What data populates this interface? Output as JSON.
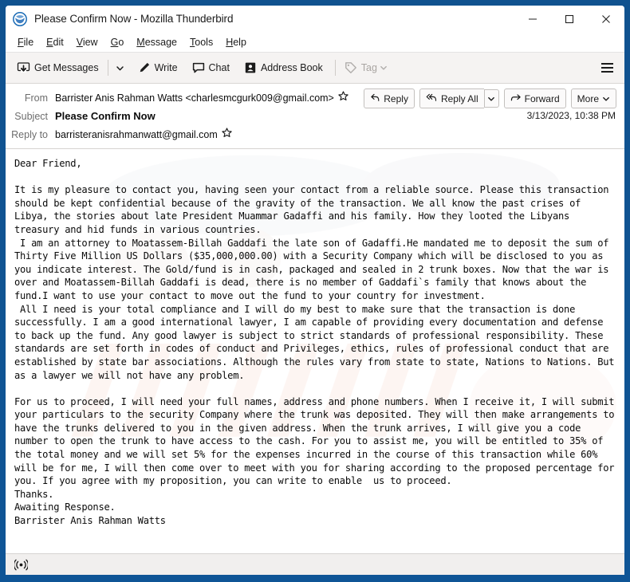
{
  "window": {
    "title": "Please Confirm Now - Mozilla Thunderbird",
    "app_icon": "thunderbird-icon",
    "controls": {
      "minimize": "minimize-icon",
      "maximize": "maximize-icon",
      "close": "close-icon"
    },
    "frame_color": "#0f5596"
  },
  "menubar": {
    "items": [
      {
        "label": "File",
        "accel": "F"
      },
      {
        "label": "Edit",
        "accel": "E"
      },
      {
        "label": "View",
        "accel": "V"
      },
      {
        "label": "Go",
        "accel": "G"
      },
      {
        "label": "Message",
        "accel": "M"
      },
      {
        "label": "Tools",
        "accel": "T"
      },
      {
        "label": "Help",
        "accel": "H"
      }
    ]
  },
  "toolbar": {
    "get_messages_label": "Get Messages",
    "write_label": "Write",
    "chat_label": "Chat",
    "address_book_label": "Address Book",
    "tag_label": "Tag",
    "tag_disabled": true,
    "menu_icon": "hamburger-icon"
  },
  "message_header": {
    "from_label": "From",
    "from_value": "Barrister Anis Rahman Watts <charlesmcgurk009@gmail.com>",
    "subject_label": "Subject",
    "subject_value": "Please Confirm Now",
    "reply_to_label": "Reply to",
    "reply_to_value": "barristeranisrahmanwatt@gmail.com",
    "date": "3/13/2023, 10:38 PM",
    "actions": {
      "reply": "Reply",
      "reply_all": "Reply All",
      "forward": "Forward",
      "more": "More"
    }
  },
  "message_body": {
    "text": "Dear Friend,\n\nIt is my pleasure to contact you, having seen your contact from a reliable source. Please this transaction should be kept confidential because of the gravity of the transaction. We all know the past crises of Libya, the stories about late President Muammar Gadaffi and his family. How they looted the Libyans treasury and hid funds in various countries.\n I am an attorney to Moatassem-Billah Gaddafi the late son of Gadaffi.He mandated me to deposit the sum of Thirty Five Million US Dollars ($35,000,000.00) with a Security Company which will be disclosed to you as you indicate interest. The Gold/fund is in cash, packaged and sealed in 2 trunk boxes. Now that the war is over and Moatassem-Billah Gaddafi is dead, there is no member of Gaddafi`s family that knows about the fund.I want to use your contact to move out the fund to your country for investment.\n All I need is your total compliance and I will do my best to make sure that the transaction is done successfully. I am a good international lawyer, I am capable of providing every documentation and defense to back up the fund. Any good lawyer is subject to strict standards of professional responsibility. These standards are set forth in codes of conduct and Privileges, ethics, rules of professional conduct that are established by state bar associations. Although the rules vary from state to state, Nations to Nations. But as a lawyer we will not have any problem.\n\nFor us to proceed, I will need your full names, address and phone numbers. When I receive it, I will submit your particulars to the security Company where the trunk was deposited. They will then make arrangements to have the trunks delivered to you in the given address. When the trunk arrives, I will give you a code number to open the trunk to have access to the cash. For you to assist me, you will be entitled to 35% of the total money and we will set 5% for the expenses incurred in the course of this transaction while 60% will be for me, I will then come over to meet with you for sharing according to the proposed percentage for you. If you agree with my proposition, you can write to enable  us to proceed.\nThanks.\nAwaiting Response.\nBarrister Anis Rahman Watts"
  },
  "statusbar": {
    "icon": "broadcast-icon"
  }
}
